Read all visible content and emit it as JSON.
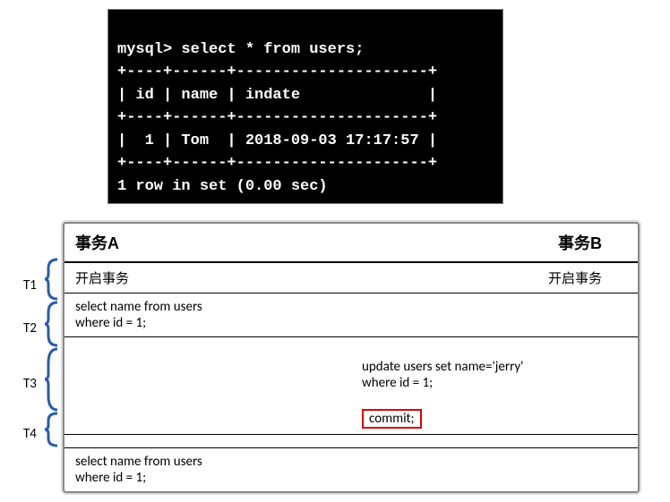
{
  "terminal": {
    "prompt": "mysql> select * from users;",
    "border_top": "+----+------+---------------------+",
    "header": "| id | name | indate              |",
    "border_mid": "+----+------+---------------------+",
    "data_row": "|  1 | Tom  | 2018-09-03 17:17:57 |",
    "border_bot": "+----+------+---------------------+",
    "footer": "1 row in set (0.00 sec)"
  },
  "table": {
    "header": {
      "colA": "事务A",
      "colB": "事务B"
    },
    "rows": [
      {
        "colA": "开启事务",
        "colB": "开启事务"
      },
      {
        "colA": "select name from users\nwhere id = 1;",
        "colB": ""
      },
      {
        "colA": "",
        "colB_line1": "update users set name='jerry'\nwhere id = 1;",
        "colB_commit": "commit;"
      },
      {
        "colA": "",
        "colB": ""
      },
      {
        "colA": "select name from users\nwhere id = 1;",
        "colB": ""
      }
    ]
  },
  "timeline": {
    "labels": [
      "T1",
      "T2",
      "T3",
      "T4"
    ]
  }
}
